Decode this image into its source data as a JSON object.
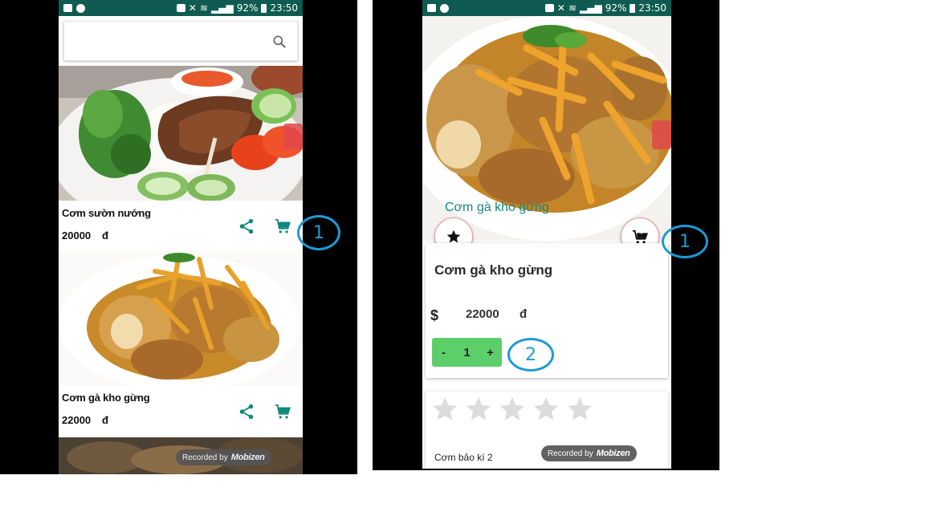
{
  "left_phone": {
    "status": {
      "battery": "92%",
      "time": "23:50"
    },
    "search": {
      "placeholder": "",
      "value": ""
    },
    "items": [
      {
        "name": "Cơm sườn nướng",
        "price": "20000",
        "currency": "đ"
      },
      {
        "name": "Cơm gà kho gừng",
        "price": "22000",
        "currency": "đ"
      }
    ],
    "recorded_label": "Recorded by",
    "recorded_brand": "Mobizen",
    "callout_1": "1"
  },
  "right_phone": {
    "status": {
      "battery": "92%",
      "time": "23:50"
    },
    "hero_title": "Cơm gà kho gừng",
    "detail": {
      "name": "Cơm gà kho gừng",
      "currency_symbol": "$",
      "price": "22000",
      "currency": "đ",
      "quantity": {
        "minus": "-",
        "value": "1",
        "plus": "+"
      }
    },
    "rating": {
      "filled_stars": 0,
      "max_stars": 5
    },
    "review_author": "Cơm bảo kí 2",
    "recorded_label": "Recorded by",
    "recorded_brand": "Mobizen",
    "callout_1": "1",
    "callout_2": "2"
  },
  "colors": {
    "statusbar": "#0f5b52",
    "accent_teal": "#10897a",
    "qty_green": "#5ccf6b",
    "callout_blue": "#1d9ad6"
  },
  "icons": [
    "search-icon",
    "share-icon",
    "cart-icon",
    "star-icon",
    "add-to-cart-icon"
  ]
}
